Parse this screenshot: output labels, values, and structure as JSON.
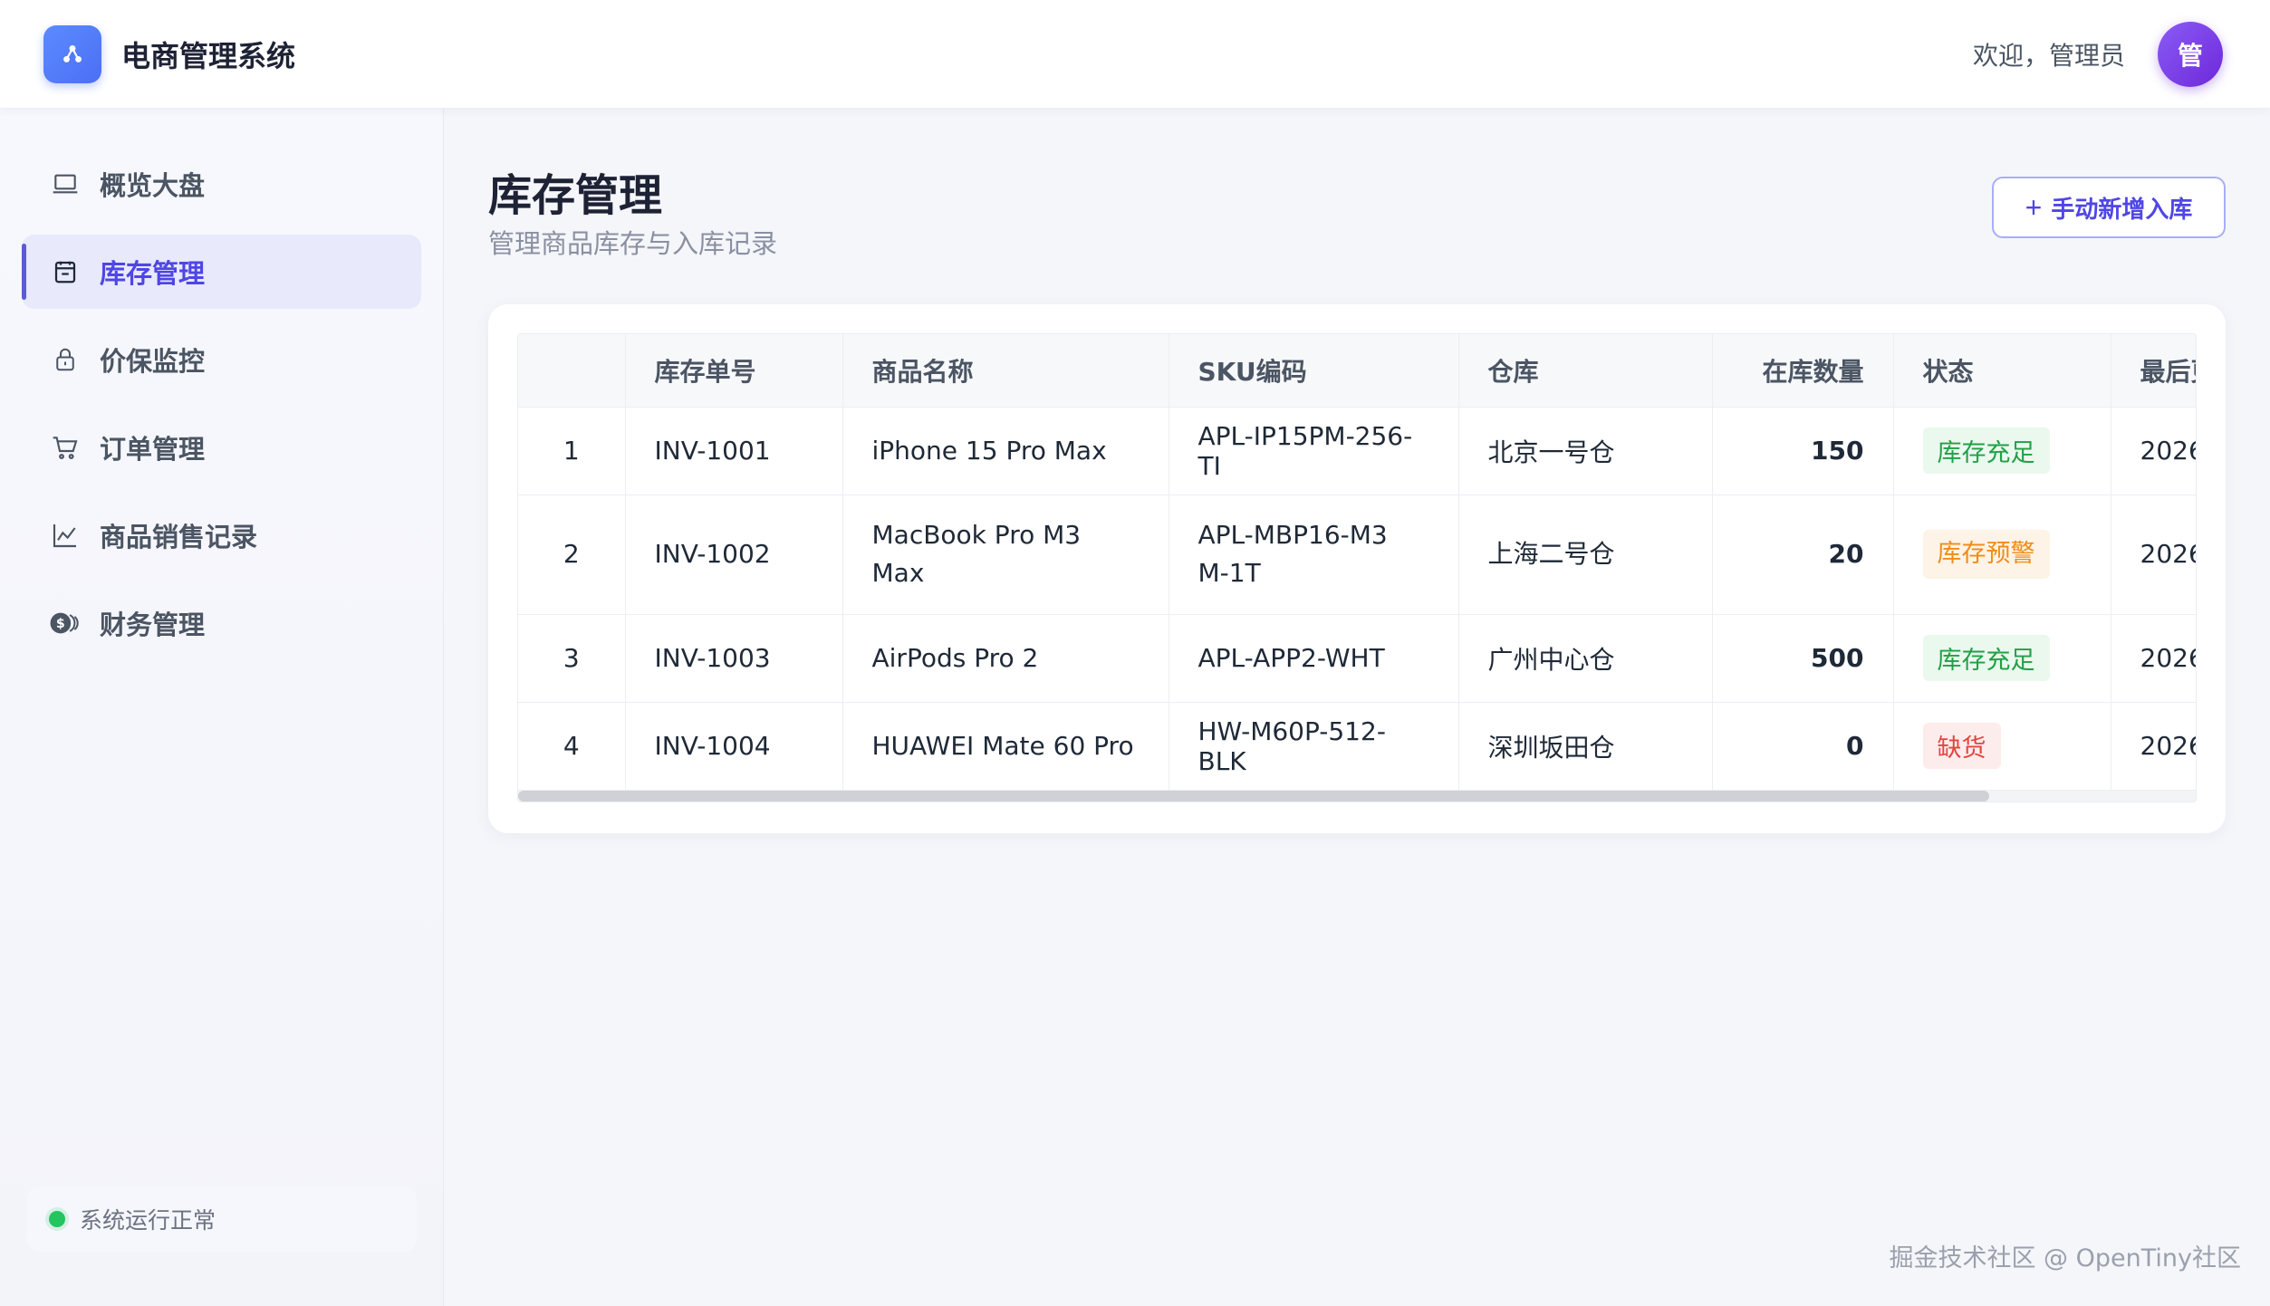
{
  "header": {
    "brand_title": "电商管理系统",
    "welcome": "欢迎，管理员",
    "avatar_text": "管"
  },
  "sidebar": {
    "items": [
      {
        "label": "概览大盘",
        "icon": "laptop-icon",
        "active": false
      },
      {
        "label": "库存管理",
        "icon": "clipboard-icon",
        "active": true
      },
      {
        "label": "价保监控",
        "icon": "lock-icon",
        "active": false
      },
      {
        "label": "订单管理",
        "icon": "cart-icon",
        "active": false
      },
      {
        "label": "商品销售记录",
        "icon": "line-chart-icon",
        "active": false
      },
      {
        "label": "财务管理",
        "icon": "coins-icon",
        "active": false
      }
    ],
    "status_text": "系统运行正常"
  },
  "main": {
    "title": "库存管理",
    "subtitle": "管理商品库存与入库记录",
    "add_button_label": "手动新增入库"
  },
  "table": {
    "columns": [
      "",
      "库存单号",
      "商品名称",
      "SKU编码",
      "仓库",
      "在库数量",
      "状态",
      "最后更新"
    ],
    "rows": [
      {
        "idx": "1",
        "inv": "INV-1001",
        "name": "iPhone 15 Pro Max",
        "sku": "APL-IP15PM-256-TI",
        "warehouse": "北京一号仓",
        "qty": "150",
        "status": "库存充足",
        "status_type": "good",
        "updated": "2026"
      },
      {
        "idx": "2",
        "inv": "INV-1002",
        "name": "MacBook Pro M3 Max",
        "sku": "APL-MBP16-M3M-1T",
        "warehouse": "上海二号仓",
        "qty": "20",
        "status": "库存预警",
        "status_type": "warn",
        "updated": "2026"
      },
      {
        "idx": "3",
        "inv": "INV-1003",
        "name": "AirPods Pro 2",
        "sku": "APL-APP2-WHT",
        "warehouse": "广州中心仓",
        "qty": "500",
        "status": "库存充足",
        "status_type": "good",
        "updated": "2026"
      },
      {
        "idx": "4",
        "inv": "INV-1004",
        "name": "HUAWEI Mate 60 Pro",
        "sku": "HW-M60P-512-BLK",
        "warehouse": "深圳坂田仓",
        "qty": "0",
        "status": "缺货",
        "status_type": "out",
        "updated": "2026"
      }
    ]
  },
  "watermark": "掘金技术社区 @ OpenTiny社区",
  "colors": {
    "accent": "#4f46e5",
    "status_good": "#22a047",
    "status_warn": "#f08c1a",
    "status_out": "#e2463f"
  }
}
